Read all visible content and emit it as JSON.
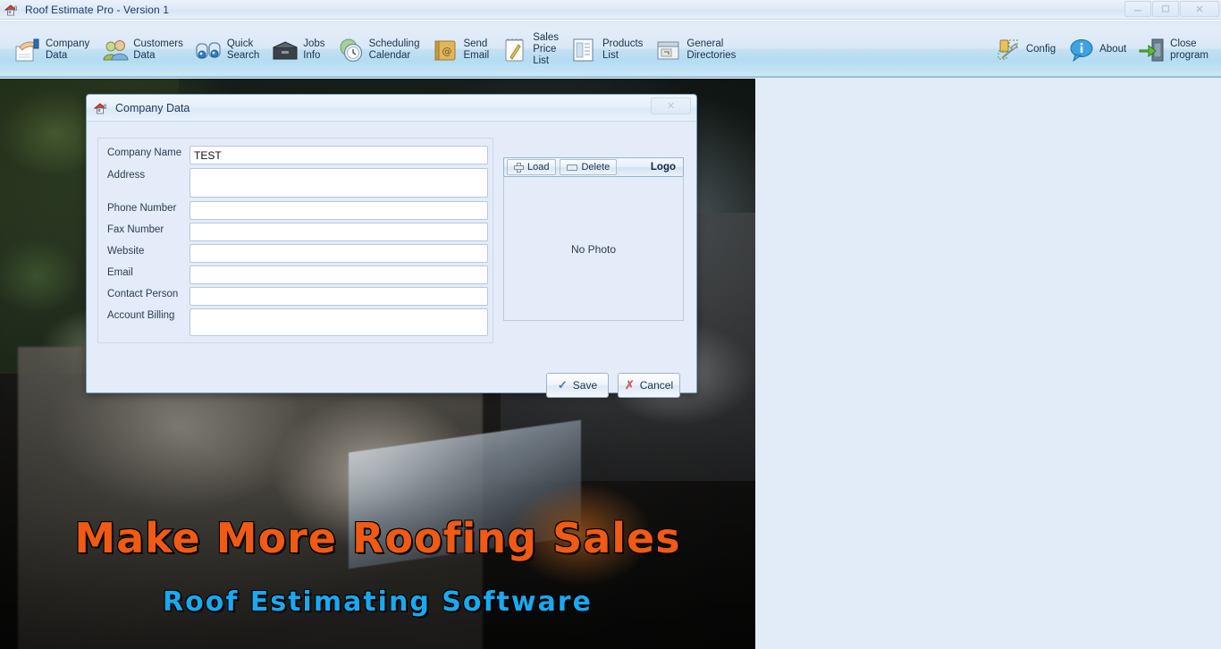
{
  "window": {
    "title": "Roof Estimate Pro - Version 1",
    "app_icon": "house-icon",
    "controls": {
      "minimize": "minimize-icon",
      "maximize": "maximize-icon",
      "close": "close-icon"
    }
  },
  "toolbar": {
    "items": [
      {
        "icon": "company-data-icon",
        "label": "Company\nData"
      },
      {
        "icon": "customers-data-icon",
        "label": "Customers\nData"
      },
      {
        "icon": "quick-search-icon",
        "label": "Quick\nSearch"
      },
      {
        "icon": "jobs-info-icon",
        "label": "Jobs\nInfo"
      },
      {
        "icon": "scheduling-calendar-icon",
        "label": "Scheduling\nCalendar"
      },
      {
        "icon": "send-email-icon",
        "label": "Send\nEmail"
      },
      {
        "icon": "sales-price-list-icon",
        "label": "Sales\nPrice\nList"
      },
      {
        "icon": "products-list-icon",
        "label": "Products\nList"
      },
      {
        "icon": "general-directories-icon",
        "label": "General\nDirectories"
      }
    ],
    "right_items": [
      {
        "icon": "config-icon",
        "label": "Config"
      },
      {
        "icon": "about-icon",
        "label": "About"
      },
      {
        "icon": "close-program-icon",
        "label": "Close\nprogram"
      }
    ]
  },
  "promo": {
    "headline": "Make More Roofing Sales",
    "subline": "Roof Estimating Software",
    "headline_color": "#f05a14",
    "subline_color": "#19a9f0"
  },
  "dialog": {
    "title": "Company Data",
    "icon": "house-icon",
    "close_label": "✕",
    "fields": [
      {
        "label": "Company Name",
        "value": "TEST",
        "placeholder": "",
        "multiline": false
      },
      {
        "label": "Address",
        "value": "",
        "placeholder": "",
        "multiline": true
      },
      {
        "label": "Phone Number",
        "value": "",
        "placeholder": "",
        "multiline": false
      },
      {
        "label": "Fax Number",
        "value": "",
        "placeholder": "",
        "multiline": false
      },
      {
        "label": "Website",
        "value": "",
        "placeholder": "",
        "multiline": false
      },
      {
        "label": "Email",
        "value": "",
        "placeholder": "",
        "multiline": false
      },
      {
        "label": "Contact Person",
        "value": "",
        "placeholder": "",
        "multiline": false
      },
      {
        "label": "Account Billing",
        "value": "",
        "placeholder": "",
        "multiline": true
      }
    ],
    "logo_panel": {
      "load_label": "Load",
      "delete_label": "Delete",
      "title": "Logo",
      "empty_text": "No Photo"
    },
    "actions": {
      "save_label": "Save",
      "cancel_label": "Cancel"
    }
  },
  "colors": {
    "toolbar_top": "#dfe9f5",
    "toolbar_bottom": "#b4dcf2",
    "dialog_bg": "#e3ecf8",
    "desktop_bg": "#e1ecf8",
    "accent_border": "#7ba2c4"
  }
}
